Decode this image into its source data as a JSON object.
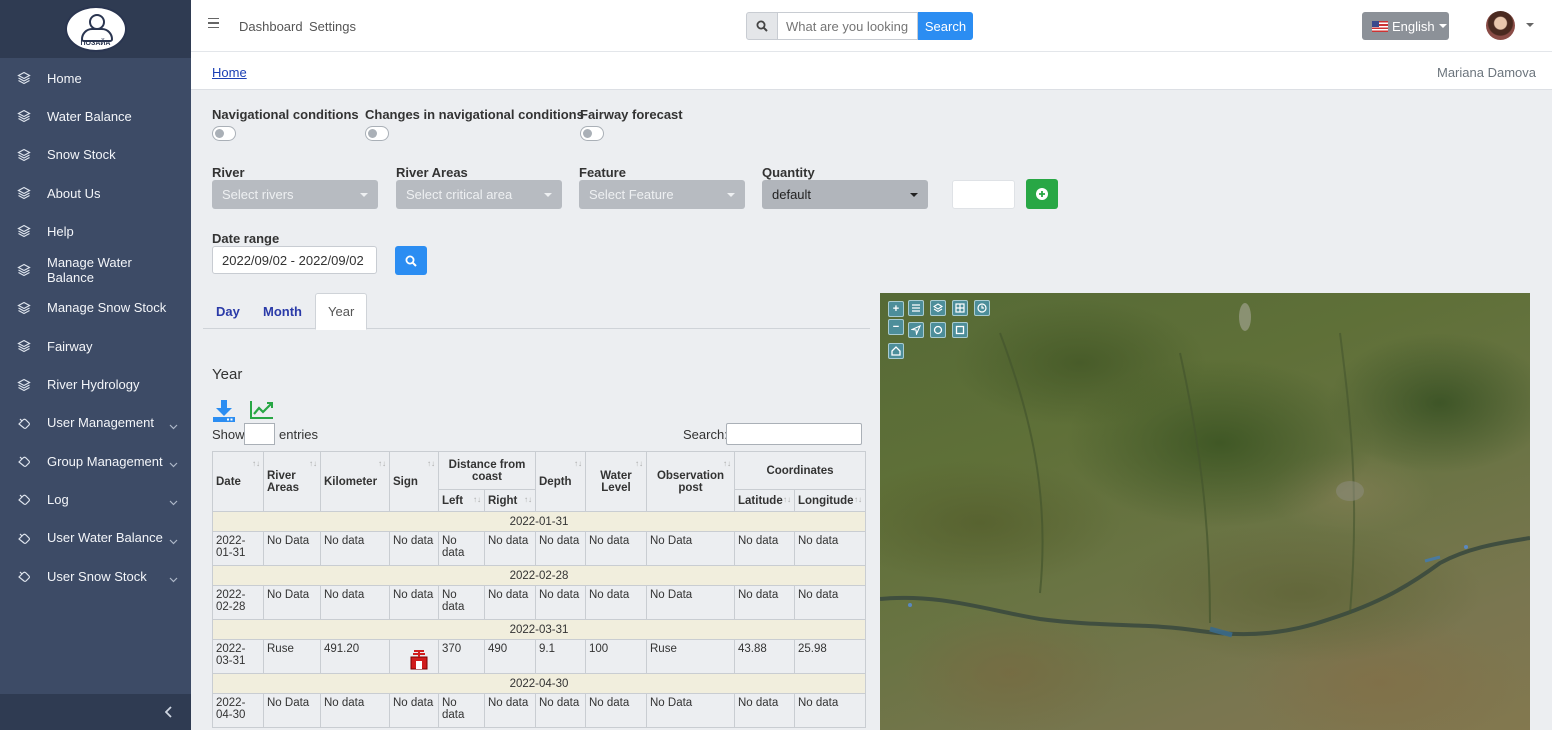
{
  "app": {
    "logo_text": "ПОЗАЙА"
  },
  "sidebar": {
    "items": [
      {
        "label": "Home",
        "icon": "layers-icon",
        "expandable": false
      },
      {
        "label": "Water Balance",
        "icon": "layers-icon",
        "expandable": false
      },
      {
        "label": "Snow Stock",
        "icon": "layers-icon",
        "expandable": false
      },
      {
        "label": "About Us",
        "icon": "layers-icon",
        "expandable": false
      },
      {
        "label": "Help",
        "icon": "layers-icon",
        "expandable": false
      },
      {
        "label": "Manage Water Balance",
        "icon": "layers-icon",
        "expandable": false
      },
      {
        "label": "Manage Snow Stock",
        "icon": "layers-icon",
        "expandable": false
      },
      {
        "label": "Fairway",
        "icon": "layers-icon",
        "expandable": false
      },
      {
        "label": "River Hydrology",
        "icon": "layers-icon",
        "expandable": false
      },
      {
        "label": "User Management",
        "icon": "hand-icon",
        "expandable": true
      },
      {
        "label": "Group Management",
        "icon": "hand-icon",
        "expandable": true
      },
      {
        "label": "Log",
        "icon": "hand-icon",
        "expandable": true
      },
      {
        "label": "User Water Balance",
        "icon": "hand-icon",
        "expandable": true
      },
      {
        "label": "User Snow Stock",
        "icon": "hand-icon",
        "expandable": true
      }
    ],
    "collapse_icon": "chevron-left-icon"
  },
  "topbar": {
    "links": [
      "Dashboard",
      "Settings"
    ],
    "search_placeholder": "What are you looking f",
    "search_button": "Search",
    "language": "English"
  },
  "breadcrumb": {
    "home": "Home",
    "user_name": "Mariana Damova"
  },
  "filters": {
    "toggles": [
      "Navigational conditions",
      "Changes in navigational conditions",
      "Fairway forecast"
    ],
    "river_label": "River",
    "river_placeholder": "Select rivers",
    "areas_label": "River Areas",
    "areas_placeholder": "Select critical area",
    "feature_label": "Feature",
    "feature_placeholder": "Select Feature",
    "quantity_label": "Quantity",
    "quantity_value": "default",
    "date_label": "Date range",
    "date_value": "2022/09/02 - 2022/09/02"
  },
  "tabs": [
    "Day",
    "Month",
    "Year"
  ],
  "active_tab": "Year",
  "table": {
    "title": "Year",
    "show_label": "Show",
    "entries_label": "entries",
    "search_label": "Search:",
    "headers": {
      "date": "Date",
      "river_areas": "River Areas",
      "kilometer": "Kilometer",
      "sign": "Sign",
      "distance": "Distance from coast",
      "left": "Left",
      "right": "Right",
      "depth": "Depth",
      "water_level": "Water Level",
      "observation_post": "Observation post",
      "coordinates": "Coordinates",
      "latitude": "Latitude",
      "longitude": "Longitude"
    },
    "groups": [
      {
        "group": "2022-01-31",
        "row": {
          "date": "2022-01-31",
          "area": "No Data",
          "km": "No data",
          "sign": "No data",
          "left": "No data",
          "right": "No data",
          "depth": "No data",
          "level": "No data",
          "post": "No Data",
          "lat": "No data",
          "lon": "No data"
        }
      },
      {
        "group": "2022-02-28",
        "row": {
          "date": "2022-02-28",
          "area": "No Data",
          "km": "No data",
          "sign": "No data",
          "left": "No data",
          "right": "No data",
          "depth": "No data",
          "level": "No data",
          "post": "No Data",
          "lat": "No data",
          "lon": "No data"
        }
      },
      {
        "group": "2022-03-31",
        "row": {
          "date": "2022-03-31",
          "area": "Ruse",
          "km": "491.20",
          "sign": "",
          "left": "370",
          "right": "490",
          "depth": "9.1",
          "level": "100",
          "post": "Ruse",
          "lat": "43.88",
          "lon": "25.98"
        }
      },
      {
        "group": "2022-04-30",
        "row": {
          "date": "2022-04-30",
          "area": "No Data",
          "km": "No data",
          "sign": "No data",
          "left": "No data",
          "right": "No data",
          "depth": "No data",
          "level": "No data",
          "post": "No Data",
          "lat": "No data",
          "lon": "No data"
        }
      }
    ]
  },
  "map": {
    "controls": [
      "+",
      "−"
    ]
  }
}
